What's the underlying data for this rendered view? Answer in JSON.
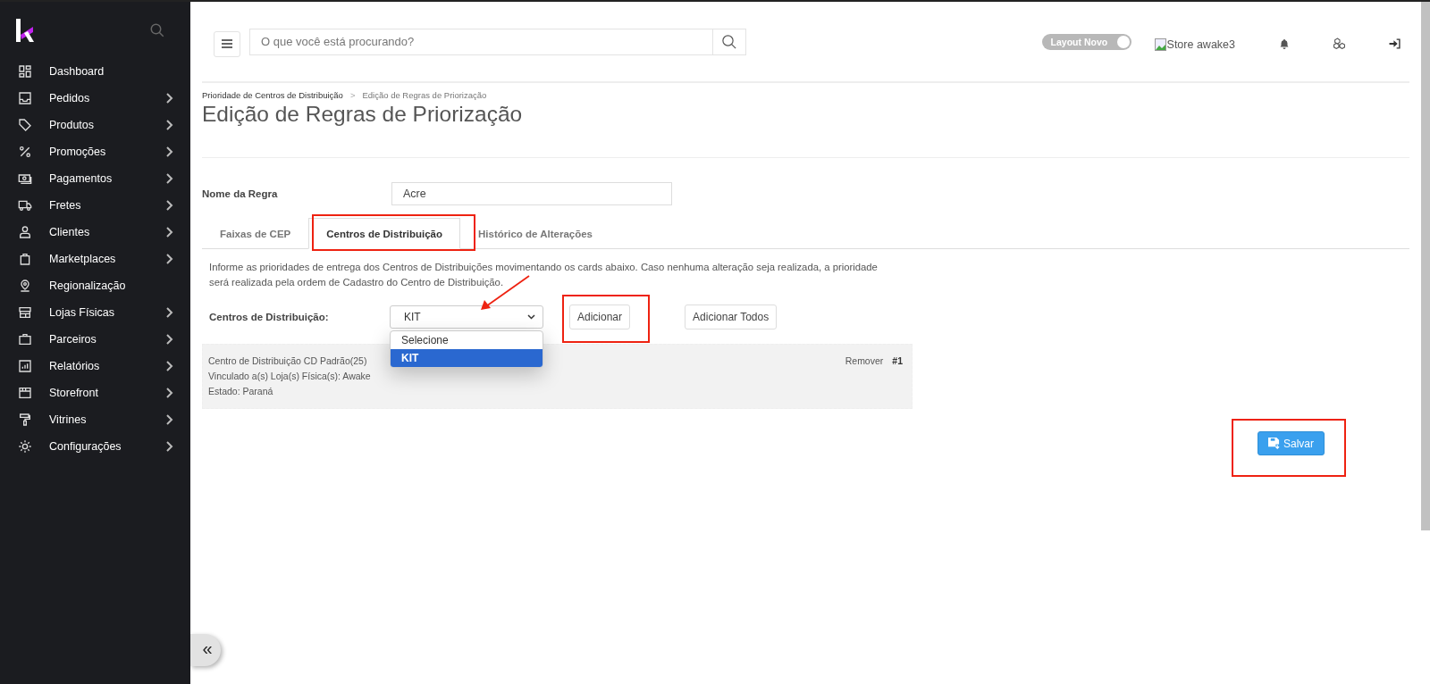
{
  "sidebar": {
    "items": [
      {
        "label": "Dashboard",
        "expandable": false
      },
      {
        "label": "Pedidos",
        "expandable": true
      },
      {
        "label": "Produtos",
        "expandable": true
      },
      {
        "label": "Promoções",
        "expandable": true
      },
      {
        "label": "Pagamentos",
        "expandable": true
      },
      {
        "label": "Fretes",
        "expandable": true
      },
      {
        "label": "Clientes",
        "expandable": true
      },
      {
        "label": "Marketplaces",
        "expandable": true
      },
      {
        "label": "Regionalização",
        "expandable": false
      },
      {
        "label": "Lojas Físicas",
        "expandable": true
      },
      {
        "label": "Parceiros",
        "expandable": true
      },
      {
        "label": "Relatórios",
        "expandable": true
      },
      {
        "label": "Storefront",
        "expandable": true
      },
      {
        "label": "Vitrines",
        "expandable": true
      },
      {
        "label": "Configurações",
        "expandable": true
      }
    ]
  },
  "header": {
    "search": {
      "placeholder": "O que você está procurando?"
    },
    "layout_toggle": {
      "label": "Layout Novo",
      "on": true
    },
    "store_image_alt": "Store awake3"
  },
  "breadcrumb": [
    "Prioridade de Centros de Distribuição",
    "Edição de Regras de Priorização"
  ],
  "breadcrumb_separator": ">",
  "title": "Edição de Regras de Priorização",
  "rule_name": {
    "label": "Nome da Regra",
    "value": "Acre"
  },
  "tabs": [
    {
      "label": "Faixas de CEP",
      "selected": false
    },
    {
      "label": "Centros de Distribuição",
      "selected": true
    },
    {
      "label": "Histórico de Alterações",
      "selected": false
    }
  ],
  "description": "Informe as prioridades de entrega dos Centros de Distribuições movimentando os cards abaixo. Caso nenhuma alteração seja realizada, a prioridade será realizada pela ordem de Cadastro do Centro de Distribuição.",
  "distribution_centers": {
    "label": "Centros de Distribuição:",
    "value": "KIT",
    "options": [
      {
        "label": "Selecione",
        "selected": false
      },
      {
        "label": "KIT",
        "selected": true
      }
    ],
    "add_button": "Adicionar",
    "add_all_button": "Adicionar Todos"
  },
  "cards": [
    {
      "lines": [
        "Centro de Distribuição CD Padrão(25)",
        "Vinculado a(s) Loja(s) Física(s): Awake",
        "Estado: Paraná"
      ],
      "remove": "Remover",
      "position": "#1"
    }
  ],
  "save_button": "Salvar",
  "collapse_button": "«"
}
